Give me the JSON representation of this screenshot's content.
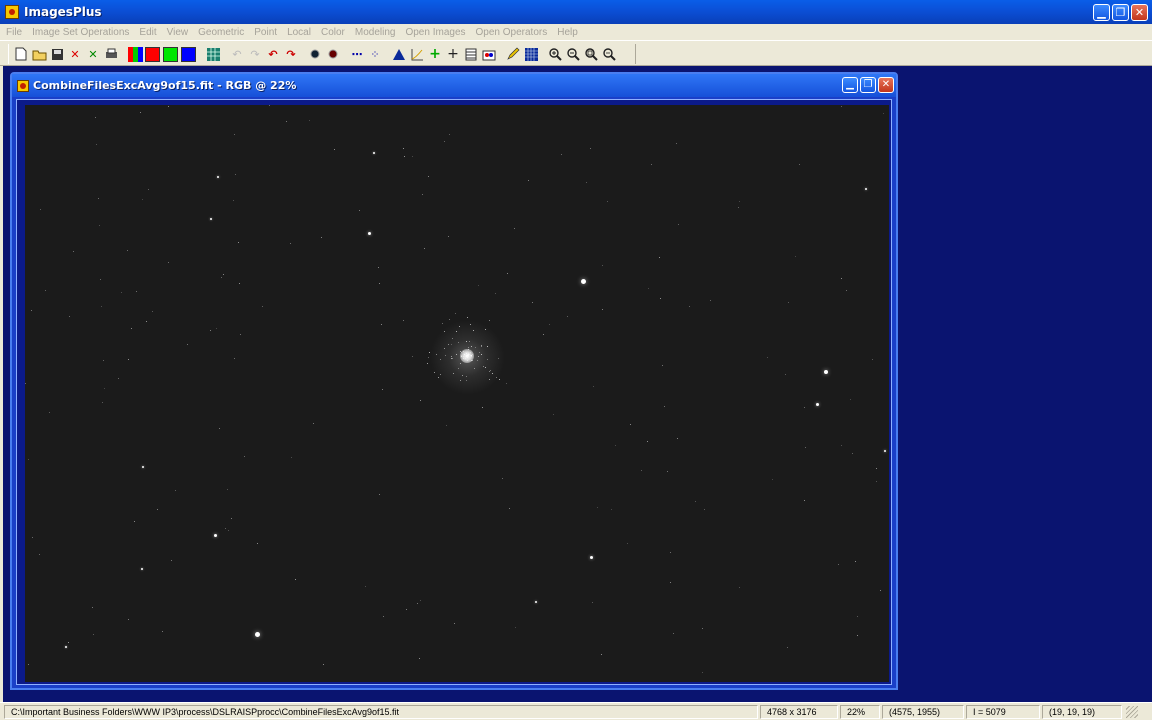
{
  "app": {
    "title": "ImagesPlus"
  },
  "menu": [
    "File",
    "Image Set Operations",
    "Edit",
    "View",
    "Geometric",
    "Point",
    "Local",
    "Color",
    "Modeling",
    "Open Images",
    "Open Operators",
    "Help"
  ],
  "toolbar": {
    "icons": [
      "new-file-icon",
      "open-folder-icon",
      "save-icon",
      "close-red-icon",
      "close-green-icon",
      "print-icon",
      "rgb-channels-icon",
      "red-channel-icon",
      "green-channel-icon",
      "blue-channel-icon",
      "grid-icon",
      "undo-disabled-icon",
      "redo-disabled-icon",
      "undo-icon",
      "redo-icon",
      "circle-dark-icon",
      "circle-red-icon",
      "dots-line-icon",
      "dots-scatter-icon",
      "histogram-icon",
      "curve-icon",
      "crosshair-green-icon",
      "crosshair-icon",
      "table-icon",
      "color-picker-icon",
      "pencil-icon",
      "mosaic-icon",
      "zoom-in-icon",
      "zoom-out-icon",
      "zoom-fit-icon",
      "zoom-actual-icon"
    ],
    "channel_colors": {
      "red": "#ff0000",
      "green": "#00e600",
      "blue": "#0000ff"
    }
  },
  "child_window": {
    "title": "CombineFilesExcAvg9of15.fit - RGB @ 22%"
  },
  "status": {
    "path": "C:\\Important Business Folders\\WWW IP3\\process\\DSLRAISPprocc\\CombineFilesExcAvg9of15.fit",
    "dimensions": "4768 x 3176",
    "zoom": "22%",
    "cursor": "(4575, 1955)",
    "intensity": "I = 5079",
    "rgb": "(19, 19, 19)"
  },
  "colors": {
    "desktop": "#0a1470",
    "image_bg": "#1b1b1b",
    "titlebar": "#0b4fd6"
  }
}
